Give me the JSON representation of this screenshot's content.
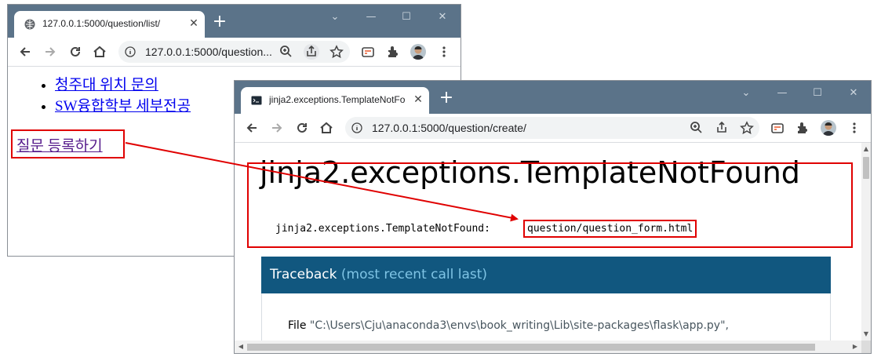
{
  "window1": {
    "tab_title": "127.0.0.1:5000/question/list/",
    "url": "127.0.0.1:5000/question...",
    "questions": [
      "청주대 위치 문의",
      "SW융합학부 세부전공"
    ],
    "create_link": "질문 등록하기"
  },
  "window2": {
    "tab_title": "jinja2.exceptions.TemplateNotFo",
    "url": "127.0.0.1:5000/question/create/",
    "error_title": "jinja2.exceptions.TemplateNotFound",
    "error_message": "jinja2.exceptions.TemplateNotFound:",
    "error_template": "question/question_form.html",
    "traceback_title": "Traceback",
    "traceback_subtitle": "(most recent call last)",
    "traceback_file_label": "File",
    "traceback_file_path": "\"C:\\Users\\Cju\\anaconda3\\envs\\book_writing\\Lib\\site-packages\\flask\\app.py\","
  },
  "colors": {
    "titlebar": "#5b7389",
    "annotation_red": "#e00000",
    "traceback_header": "#11577f",
    "link": "#0000ee",
    "visited_link": "#551a8b"
  },
  "icons": [
    "globe-icon",
    "terminal-icon",
    "close-icon",
    "plus-icon",
    "minimize-icon",
    "maximize-icon",
    "chevron-down-icon",
    "back-icon",
    "forward-icon",
    "reload-icon",
    "home-icon",
    "info-icon",
    "zoom-icon",
    "share-icon",
    "star-icon",
    "tab-search-icon",
    "extensions-icon",
    "avatar",
    "kebab-menu-icon"
  ]
}
